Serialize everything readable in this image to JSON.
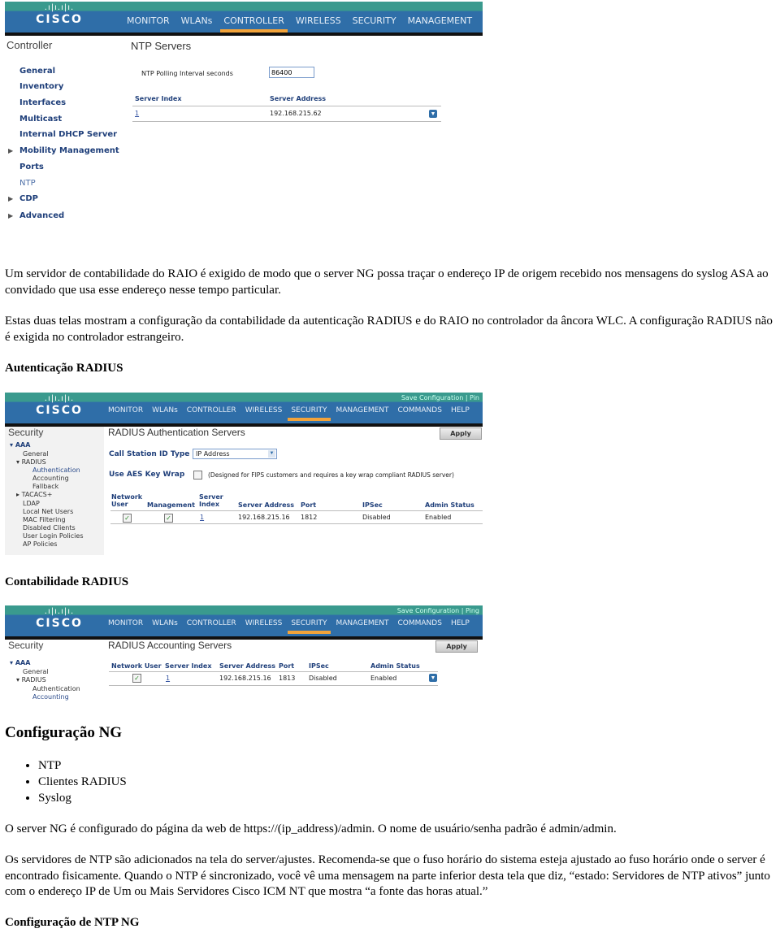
{
  "screen1": {
    "logo": "CISCO",
    "nav": [
      "MONITOR",
      "WLANs",
      "CONTROLLER",
      "WIRELESS",
      "SECURITY",
      "MANAGEMENT"
    ],
    "active_nav": "CONTROLLER",
    "sidebar_title": "Controller",
    "sidebar_items": [
      "General",
      "Inventory",
      "Interfaces",
      "Multicast",
      "Internal DHCP Server",
      "Mobility Management",
      "Ports",
      "NTP",
      "CDP",
      "Advanced"
    ],
    "current_item": "NTP",
    "page_title": "NTP Servers",
    "polling_label": "NTP Polling Interval seconds",
    "polling_value": "86400",
    "columns": [
      "Server Index",
      "Server Address"
    ],
    "rows": [
      {
        "index": "1",
        "address": "192.168.215.62"
      }
    ]
  },
  "text": {
    "p1": "Um servidor de contabilidade do RAIO é exigido de modo que o server NG possa traçar o endereço IP de origem recebido nos mensagens do syslog ASA ao convidado que usa esse endereço nesse tempo particular.",
    "p2": "Estas duas telas mostram a configuração da contabilidade da autenticação RADIUS e do RAIO no controlador da âncora WLC. A configuração RADIUS não é exigida no controlador estrangeiro.",
    "h_auth": "Autenticação RADIUS",
    "h_acct": "Contabilidade RADIUS",
    "h_ng": "Configuração NG",
    "ng_list": [
      "NTP",
      "Clientes RADIUS",
      "Syslog"
    ],
    "p3": "O server NG é configurado do página da web de https://(ip_address)/admin. O nome de usuário/senha padrão é admin/admin.",
    "p4": "Os servidores de NTP são adicionados na tela do server/ajustes. Recomenda-se que o fuso horário do sistema esteja ajustado ao fuso horário onde o server é encontrado fisicamente. Quando o NTP é sincronizado, você vê uma mensagem na parte inferior desta tela que diz, “estado: Servidores de NTP ativos” junto com o endereço IP de Um ou Mais Servidores Cisco ICM NT que mostra “a fonte das horas atual.”",
    "h_ntp": "Configuração de NTP NG"
  },
  "screen2": {
    "logo": "CISCO",
    "nav": [
      "MONITOR",
      "WLANs",
      "CONTROLLER",
      "WIRELESS",
      "SECURITY",
      "MANAGEMENT",
      "COMMANDS",
      "HELP"
    ],
    "active_nav": "SECURITY",
    "util": "Save Configuration | Pin",
    "sidebar_title": "Security",
    "sidebar_items": [
      "AAA",
      "General",
      "RADIUS",
      "Authentication",
      "Accounting",
      "Fallback",
      "TACACS+",
      "LDAP",
      "Local Net Users",
      "MAC Filtering",
      "Disabled Clients",
      "User Login Policies",
      "AP Policies"
    ],
    "page_title": "RADIUS Authentication Servers",
    "apply": "Apply",
    "call_station_label": "Call Station ID Type",
    "call_station_value": "IP Address",
    "aes_label": "Use AES Key Wrap",
    "aes_note": "(Designed for FIPS customers and requires a key wrap compliant RADIUS server)",
    "columns": [
      "Network User",
      "Management",
      "Server Index",
      "Server Address",
      "Port",
      "IPSec",
      "Admin Status"
    ],
    "rows": [
      {
        "network_user": true,
        "management": true,
        "index": "1",
        "address": "192.168.215.16",
        "port": "1812",
        "ipsec": "Disabled",
        "status": "Enabled"
      }
    ]
  },
  "screen3": {
    "logo": "CISCO",
    "nav": [
      "MONITOR",
      "WLANs",
      "CONTROLLER",
      "WIRELESS",
      "SECURITY",
      "MANAGEMENT",
      "COMMANDS",
      "HELP"
    ],
    "active_nav": "SECURITY",
    "util": "Save Configuration | Ping",
    "sidebar_title": "Security",
    "sidebar_items": [
      "AAA",
      "General",
      "RADIUS",
      "Authentication",
      "Accounting"
    ],
    "page_title": "RADIUS Accounting Servers",
    "apply": "Apply",
    "columns": [
      "Network User",
      "Server Index",
      "Server Address",
      "Port",
      "IPSec",
      "Admin Status"
    ],
    "rows": [
      {
        "network_user": true,
        "index": "1",
        "address": "192.168.215.16",
        "port": "1813",
        "ipsec": "Disabled",
        "status": "Enabled"
      }
    ]
  }
}
